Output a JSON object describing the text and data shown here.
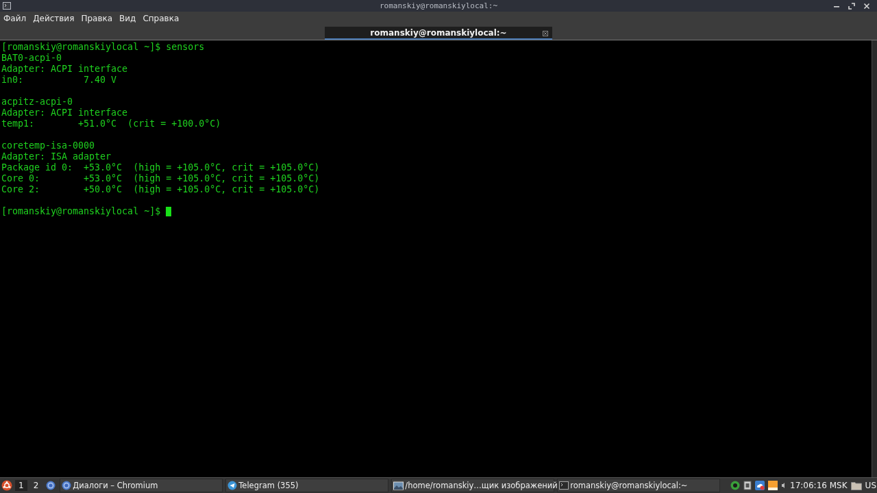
{
  "window": {
    "title": "romanskiy@romanskiylocal:~"
  },
  "menu": [
    "Файл",
    "Действия",
    "Правка",
    "Вид",
    "Справка"
  ],
  "tabs": [
    {
      "label": "romanskiy@romanskiylocal:~",
      "selected": true
    }
  ],
  "terminal": {
    "prompt": "[romanskiy@romanskiylocal ~]$",
    "command": "sensors",
    "blocks": [
      {
        "lines": [
          "BAT0-acpi-0",
          "Adapter: ACPI interface",
          "in0:           7.40 V"
        ]
      },
      {
        "lines": [
          "acpitz-acpi-0",
          "Adapter: ACPI interface",
          "temp1:        +51.0°C  (crit = +100.0°C)"
        ]
      },
      {
        "lines": [
          "coretemp-isa-0000",
          "Adapter: ISA adapter",
          "Package id 0:  +53.0°C  (high = +105.0°C, crit = +105.0°C)",
          "Core 0:        +53.0°C  (high = +105.0°C, crit = +105.0°C)",
          "Core 2:        +50.0°C  (high = +105.0°C, crit = +105.0°C)"
        ]
      }
    ],
    "final_prompt": "[romanskiy@romanskiylocal ~]$",
    "cursor_visible": true
  },
  "taskbar": {
    "workspaces": [
      {
        "label": "1",
        "selected": true
      },
      {
        "label": "2",
        "selected": false
      }
    ],
    "tasks": [
      {
        "kind": "browser",
        "label": "Диалоги – Chromium"
      },
      {
        "kind": "telegram",
        "label": "Telegram (355)"
      },
      {
        "kind": "image",
        "label": "/home/romanskiy…щик изображений"
      },
      {
        "kind": "terminal",
        "label": "romanskiy@romanskiylocal:~"
      }
    ],
    "clock": "17:06:16 MSK",
    "keyboard_layout": "US"
  }
}
